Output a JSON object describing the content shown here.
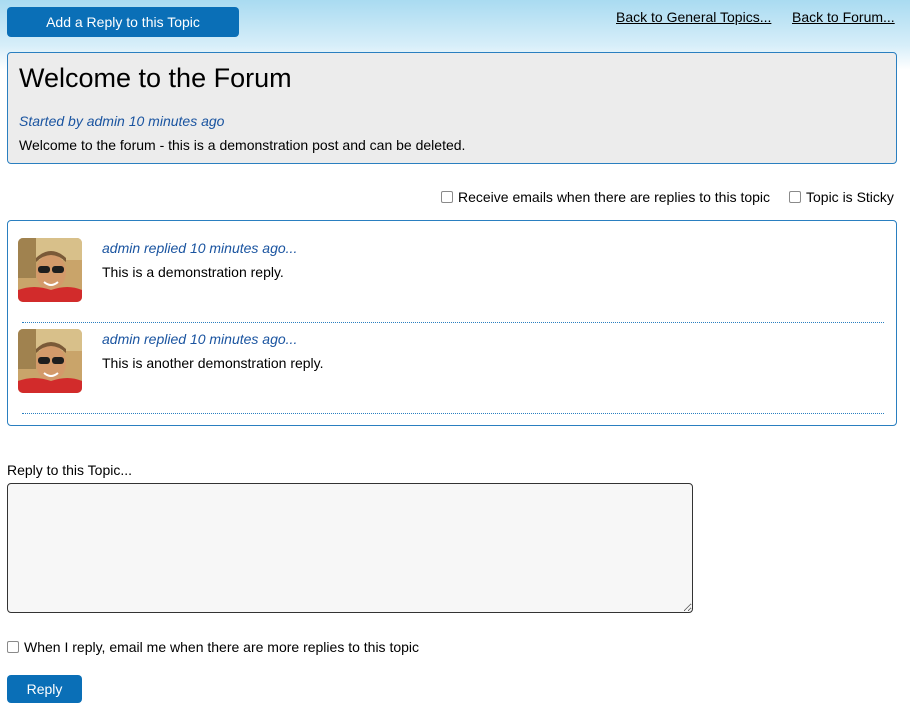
{
  "header": {
    "add_reply_label": "Add a Reply to this Topic",
    "back_general_label": "Back to General Topics...",
    "back_forum_label": "Back to Forum..."
  },
  "topic": {
    "title": "Welcome to the Forum",
    "meta": "Started by admin 10 minutes ago",
    "body": "Welcome to the forum - this is a demonstration post and can be deleted."
  },
  "options": {
    "email_replies_label": "Receive emails when there are replies to this topic",
    "sticky_label": "Topic is Sticky"
  },
  "replies": [
    {
      "meta": "admin replied 10 minutes ago...",
      "text": "This is a demonstration reply."
    },
    {
      "meta": "admin replied 10 minutes ago...",
      "text": "This is another demonstration reply."
    }
  ],
  "reply_form": {
    "label": "Reply to this Topic...",
    "textarea_value": "",
    "notify_label": "When I reply, email me when there are more replies to this topic",
    "submit_label": "Reply"
  },
  "colors": {
    "accent": "#0a6fb7",
    "link_italic": "#1a54a0",
    "border": "#2a7fc0"
  }
}
